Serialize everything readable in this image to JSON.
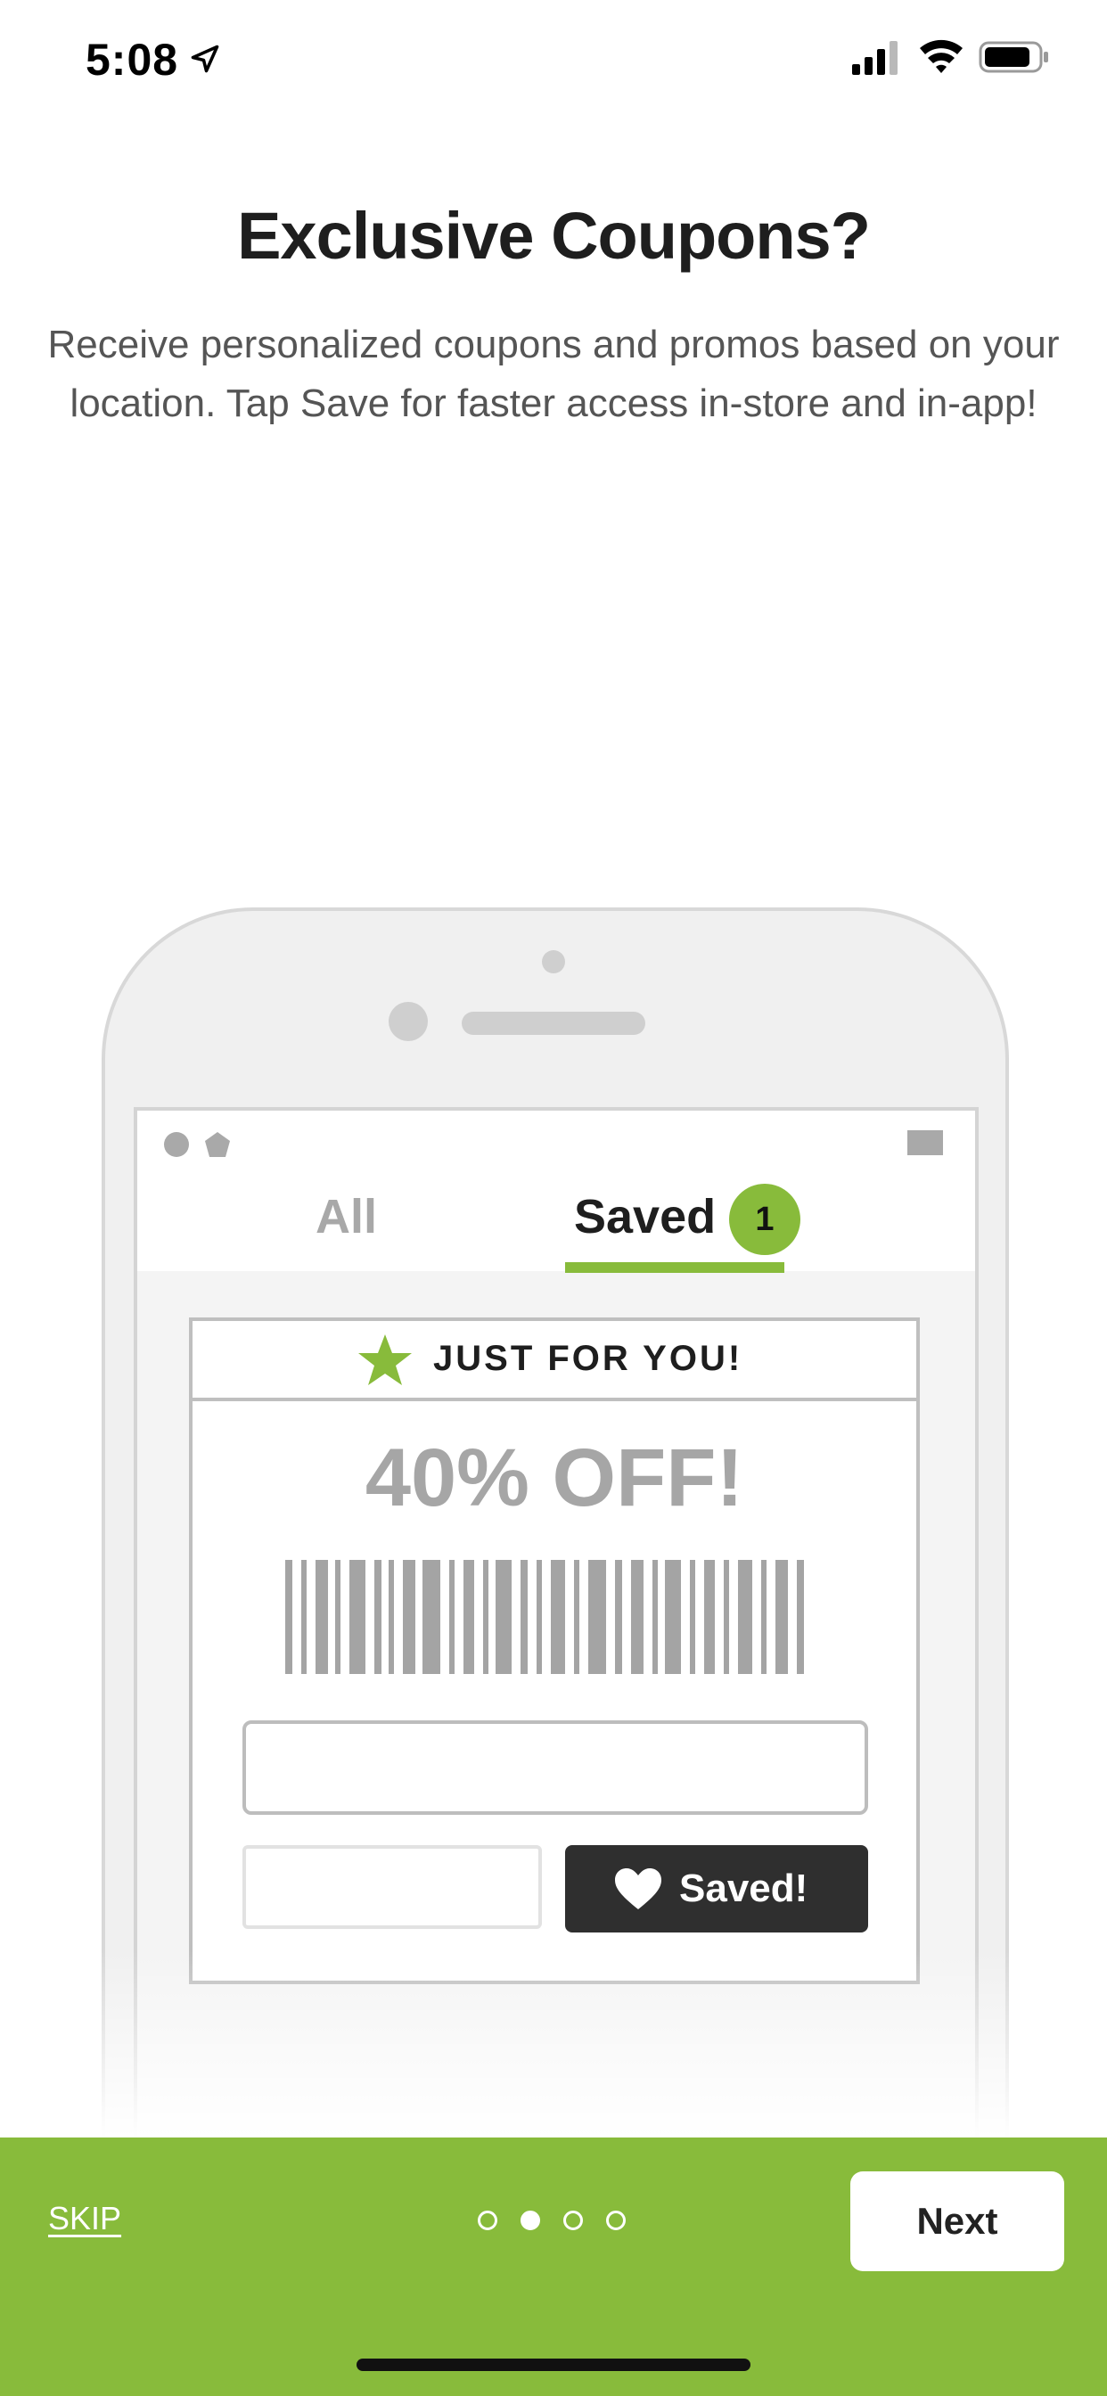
{
  "status_bar": {
    "time": "5:08"
  },
  "header": {
    "title": "Exclusive Coupons?",
    "subtitle": "Receive personalized coupons and promos based on your location. Tap Save for faster access in-store and in-app!"
  },
  "illustration": {
    "tabs": {
      "all_label": "All",
      "saved_label": "Saved",
      "saved_count": "1"
    },
    "coupon": {
      "header_label": "JUST FOR YOU!",
      "discount": "40% OFF!",
      "saved_button_label": "Saved!"
    }
  },
  "footer": {
    "skip_label": "SKIP",
    "next_label": "Next",
    "page_count": 4,
    "current_page": 2
  },
  "colors": {
    "accent": "#88bb3b",
    "dark_button": "#2f2f2f",
    "muted_text": "#a6a6a6"
  }
}
